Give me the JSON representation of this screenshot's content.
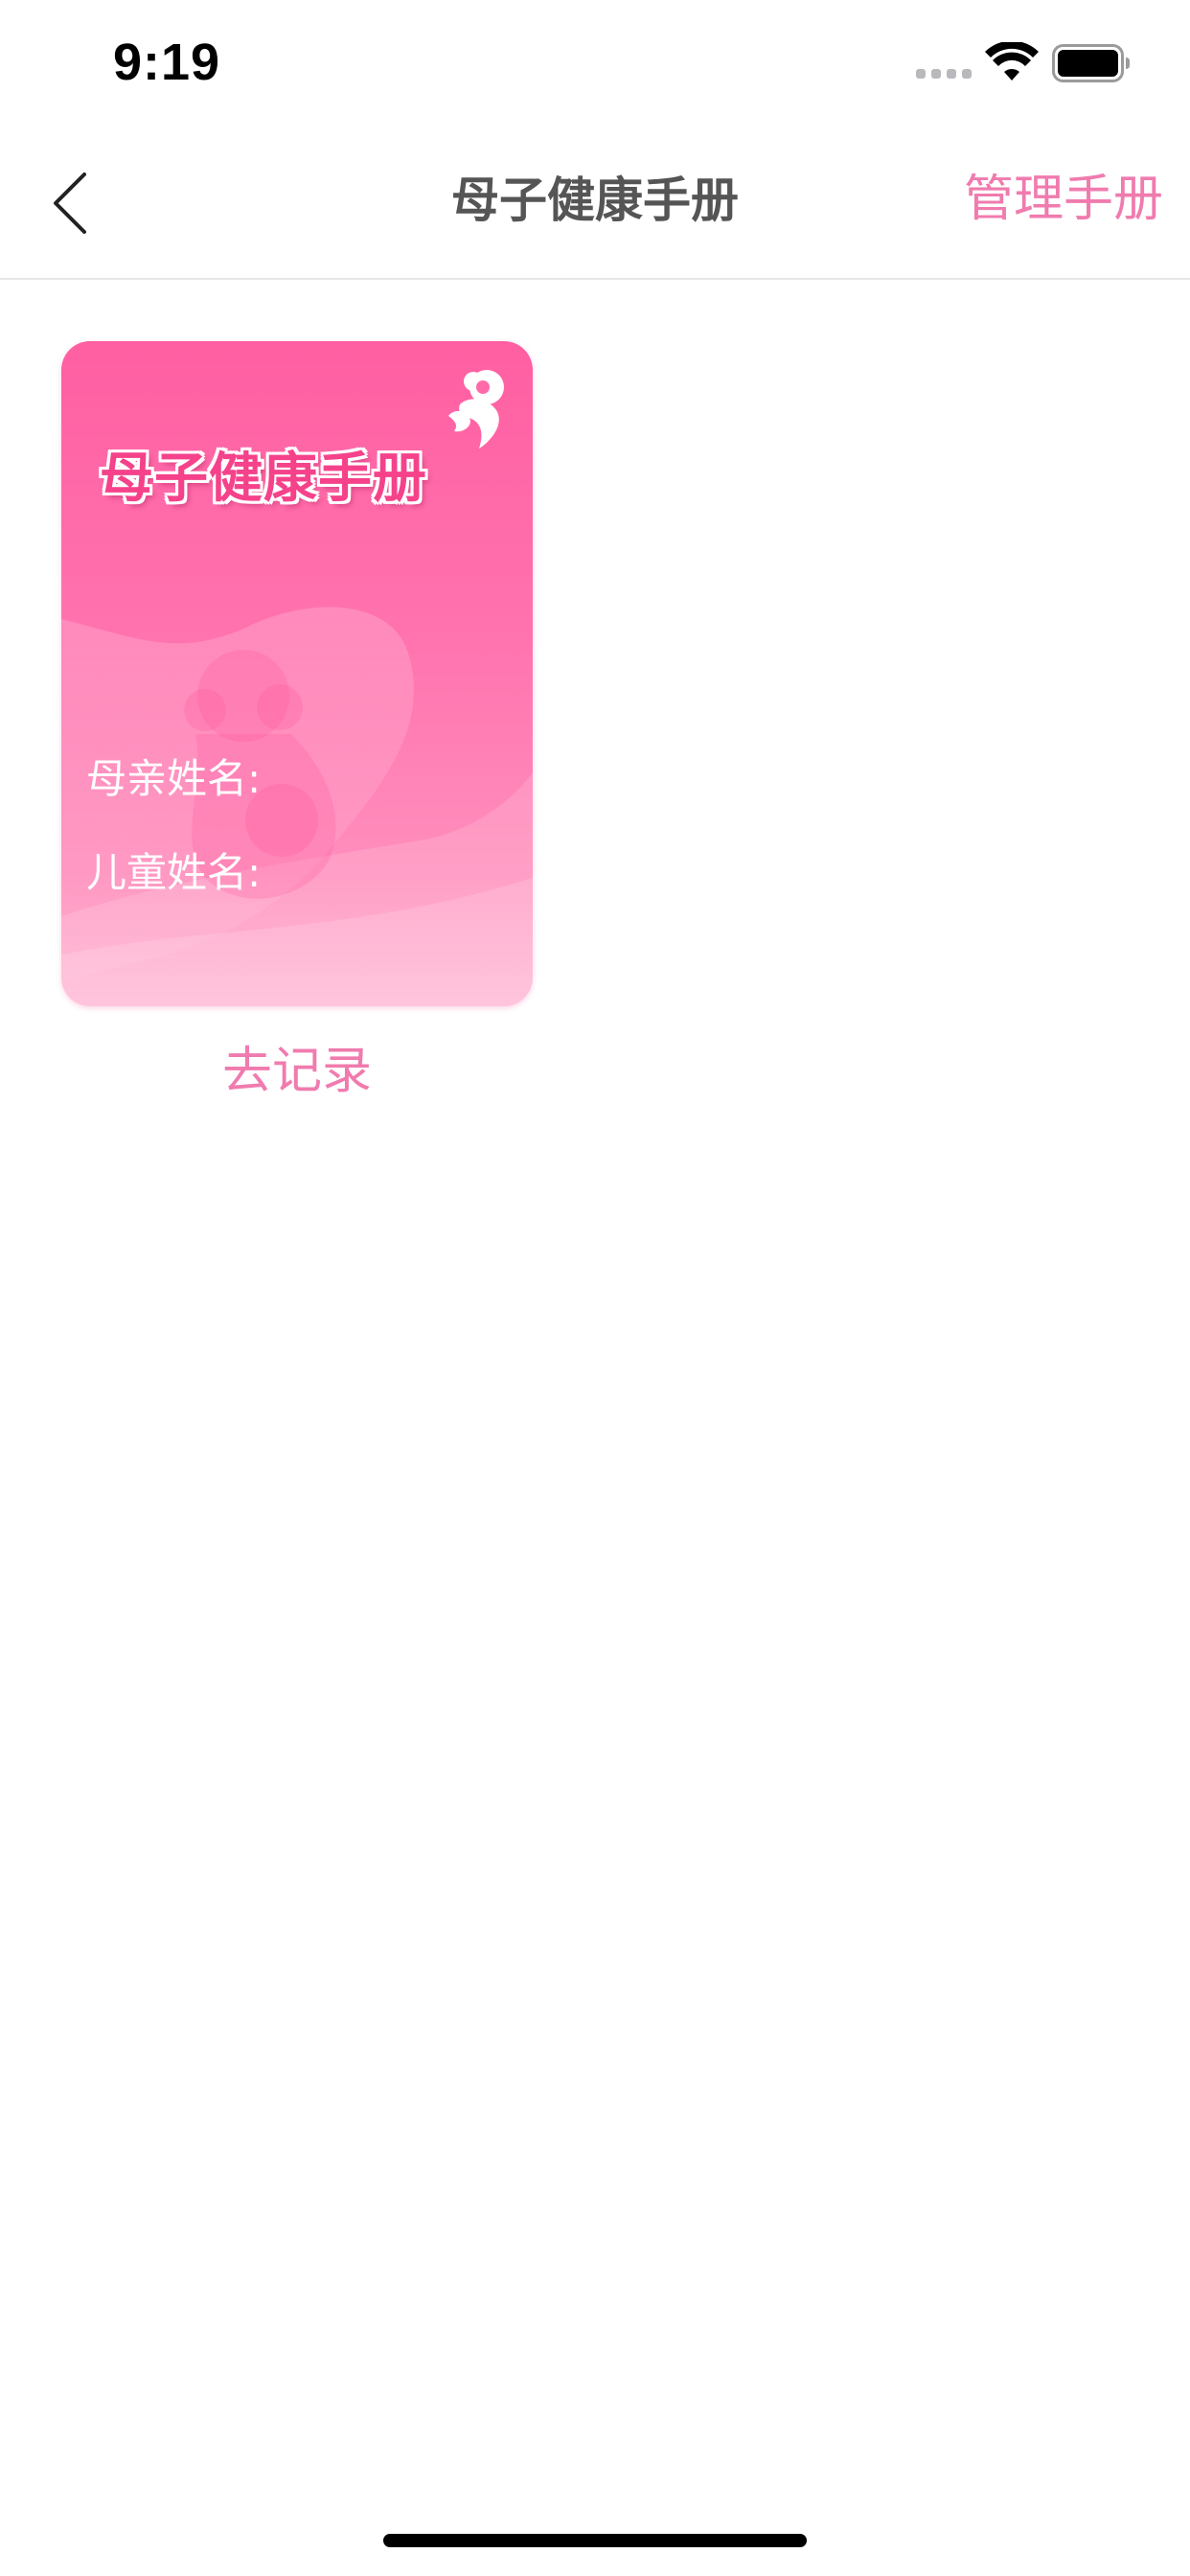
{
  "status_bar": {
    "time": "9:19",
    "icons": [
      "cellular-signal-icon",
      "wifi-icon",
      "battery-icon"
    ]
  },
  "nav": {
    "back_icon": "chevron-left-icon",
    "title": "母子健康手册",
    "manage_label": "管理手册"
  },
  "handbooks": [
    {
      "cover_title": "母子健康手册",
      "mother_name_label": "母亲姓名:",
      "child_name_label": "儿童姓名:",
      "record_label": "去记录"
    }
  ],
  "colors": {
    "accent_pink": "#f07bae",
    "cover_top": "#ff5fa2",
    "cover_bottom": "#ffb1d0",
    "title_gray": "#555555"
  }
}
